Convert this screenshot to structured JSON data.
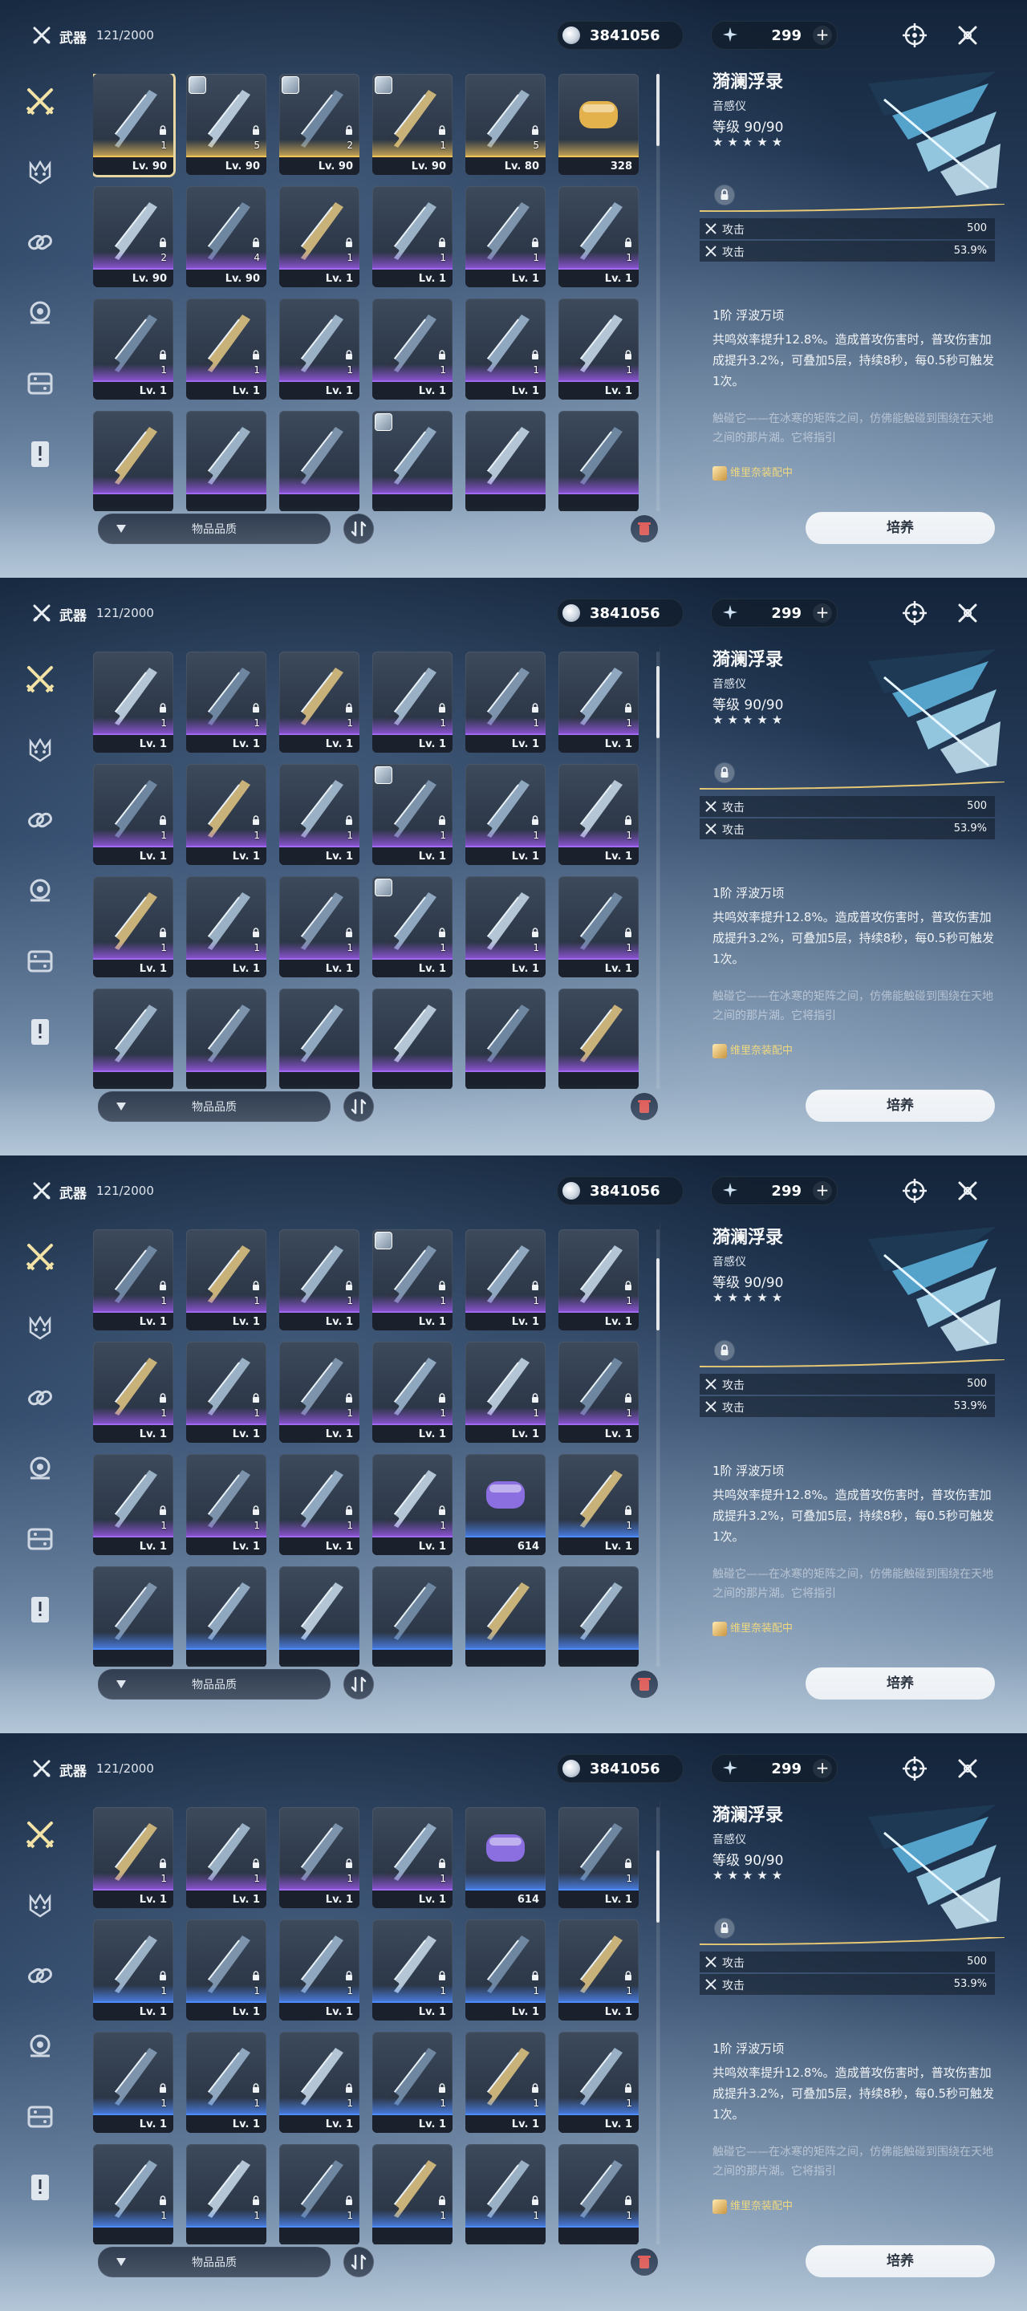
{
  "topbar": {
    "title": "武器",
    "count": "121/2000",
    "currency": "3841056",
    "gems": "299",
    "gem_plus": "+"
  },
  "filter": {
    "label": "物品品质"
  },
  "detail": {
    "name": "漪澜浮录",
    "type": "音感仪",
    "level_label": "等级",
    "level_value": "90/90",
    "stars": "★★★★★",
    "stats": [
      {
        "label": "攻击",
        "value": "500"
      },
      {
        "label": "攻击",
        "value": "53.9%"
      }
    ],
    "skill_title": "1阶 浮波万顷",
    "skill_desc": "共鸣效率提升12.8%。造成普攻伤害时，普攻伤害加成提升3.2%，可叠加5层，持续8秒，每0.5秒可触发1次。",
    "lore": "触碰它——在冰寒的矩阵之间，仿佛能触碰到围绕在天地之间的那片湖。它将指引",
    "equipped": "维里奈装配中",
    "develop": "培养"
  },
  "panels": [
    {
      "rows": [
        [
          {
            "lv": "Lv. 90",
            "n": "1",
            "q": "gold",
            "sel": true,
            "av": false
          },
          {
            "lv": "Lv. 90",
            "n": "5",
            "q": "gold",
            "av": true
          },
          {
            "lv": "Lv. 90",
            "n": "2",
            "q": "gold",
            "av": true
          },
          {
            "lv": "Lv. 90",
            "n": "1",
            "q": "gold",
            "av": true
          },
          {
            "lv": "Lv. 80",
            "n": "5",
            "q": "gold",
            "av": false
          },
          {
            "lv": "328",
            "n": "",
            "q": "gold",
            "av": false,
            "item": true
          }
        ],
        [
          {
            "lv": "Lv. 90",
            "n": "2",
            "q": "purple"
          },
          {
            "lv": "Lv. 90",
            "n": "4",
            "q": "purple"
          },
          {
            "lv": "Lv. 1",
            "n": "1",
            "q": "purple"
          },
          {
            "lv": "Lv. 1",
            "n": "1",
            "q": "purple"
          },
          {
            "lv": "Lv. 1",
            "n": "1",
            "q": "purple"
          },
          {
            "lv": "Lv. 1",
            "n": "1",
            "q": "purple"
          }
        ],
        [
          {
            "lv": "Lv. 1",
            "n": "1",
            "q": "purple"
          },
          {
            "lv": "Lv. 1",
            "n": "1",
            "q": "purple"
          },
          {
            "lv": "Lv. 1",
            "n": "1",
            "q": "purple"
          },
          {
            "lv": "Lv. 1",
            "n": "1",
            "q": "purple"
          },
          {
            "lv": "Lv. 1",
            "n": "1",
            "q": "purple"
          },
          {
            "lv": "Lv. 1",
            "n": "1",
            "q": "purple"
          }
        ],
        [
          {
            "lv": "",
            "n": "",
            "q": "purple"
          },
          {
            "lv": "",
            "n": "",
            "q": "purple"
          },
          {
            "lv": "",
            "n": "",
            "q": "purple"
          },
          {
            "lv": "",
            "n": "",
            "q": "purple",
            "av": true
          },
          {
            "lv": "",
            "n": "",
            "q": "purple"
          },
          {
            "lv": "",
            "n": "",
            "q": "purple"
          }
        ]
      ]
    },
    {
      "rows": [
        [
          {
            "lv": "Lv. 1",
            "n": "1",
            "q": "purple"
          },
          {
            "lv": "Lv. 1",
            "n": "1",
            "q": "purple"
          },
          {
            "lv": "Lv. 1",
            "n": "1",
            "q": "purple"
          },
          {
            "lv": "Lv. 1",
            "n": "1",
            "q": "purple"
          },
          {
            "lv": "Lv. 1",
            "n": "1",
            "q": "purple"
          },
          {
            "lv": "Lv. 1",
            "n": "1",
            "q": "purple"
          }
        ],
        [
          {
            "lv": "Lv. 1",
            "n": "1",
            "q": "purple"
          },
          {
            "lv": "Lv. 1",
            "n": "1",
            "q": "purple"
          },
          {
            "lv": "Lv. 1",
            "n": "1",
            "q": "purple"
          },
          {
            "lv": "Lv. 1",
            "n": "1",
            "q": "purple",
            "av": true
          },
          {
            "lv": "Lv. 1",
            "n": "1",
            "q": "purple"
          },
          {
            "lv": "Lv. 1",
            "n": "1",
            "q": "purple"
          }
        ],
        [
          {
            "lv": "Lv. 1",
            "n": "1",
            "q": "purple"
          },
          {
            "lv": "Lv. 1",
            "n": "1",
            "q": "purple"
          },
          {
            "lv": "Lv. 1",
            "n": "1",
            "q": "purple"
          },
          {
            "lv": "Lv. 1",
            "n": "1",
            "q": "purple",
            "av": true
          },
          {
            "lv": "Lv. 1",
            "n": "1",
            "q": "purple"
          },
          {
            "lv": "Lv. 1",
            "n": "1",
            "q": "purple"
          }
        ],
        [
          {
            "lv": "",
            "n": "",
            "q": "purple"
          },
          {
            "lv": "",
            "n": "",
            "q": "purple"
          },
          {
            "lv": "",
            "n": "",
            "q": "purple"
          },
          {
            "lv": "",
            "n": "",
            "q": "purple"
          },
          {
            "lv": "",
            "n": "",
            "q": "purple"
          },
          {
            "lv": "",
            "n": "",
            "q": "purple"
          }
        ]
      ]
    },
    {
      "rows": [
        [
          {
            "lv": "Lv. 1",
            "n": "1",
            "q": "purple"
          },
          {
            "lv": "Lv. 1",
            "n": "1",
            "q": "purple"
          },
          {
            "lv": "Lv. 1",
            "n": "1",
            "q": "purple"
          },
          {
            "lv": "Lv. 1",
            "n": "1",
            "q": "purple",
            "av": true
          },
          {
            "lv": "Lv. 1",
            "n": "1",
            "q": "purple"
          },
          {
            "lv": "Lv. 1",
            "n": "1",
            "q": "purple"
          }
        ],
        [
          {
            "lv": "Lv. 1",
            "n": "1",
            "q": "purple"
          },
          {
            "lv": "Lv. 1",
            "n": "1",
            "q": "purple"
          },
          {
            "lv": "Lv. 1",
            "n": "1",
            "q": "purple"
          },
          {
            "lv": "Lv. 1",
            "n": "1",
            "q": "purple"
          },
          {
            "lv": "Lv. 1",
            "n": "1",
            "q": "purple"
          },
          {
            "lv": "Lv. 1",
            "n": "1",
            "q": "purple"
          }
        ],
        [
          {
            "lv": "Lv. 1",
            "n": "1",
            "q": "purple"
          },
          {
            "lv": "Lv. 1",
            "n": "1",
            "q": "purple"
          },
          {
            "lv": "Lv. 1",
            "n": "1",
            "q": "purple"
          },
          {
            "lv": "Lv. 1",
            "n": "1",
            "q": "purple"
          },
          {
            "lv": "614",
            "n": "",
            "q": "blue",
            "item": true
          },
          {
            "lv": "Lv. 1",
            "n": "1",
            "q": "blue"
          }
        ],
        [
          {
            "lv": "",
            "n": "",
            "q": "blue"
          },
          {
            "lv": "",
            "n": "",
            "q": "blue"
          },
          {
            "lv": "",
            "n": "",
            "q": "blue"
          },
          {
            "lv": "",
            "n": "",
            "q": "blue"
          },
          {
            "lv": "",
            "n": "",
            "q": "blue"
          },
          {
            "lv": "",
            "n": "",
            "q": "blue"
          }
        ]
      ]
    },
    {
      "rows": [
        [
          {
            "lv": "Lv. 1",
            "n": "1",
            "q": "purple"
          },
          {
            "lv": "Lv. 1",
            "n": "1",
            "q": "purple"
          },
          {
            "lv": "Lv. 1",
            "n": "1",
            "q": "purple"
          },
          {
            "lv": "Lv. 1",
            "n": "1",
            "q": "purple"
          },
          {
            "lv": "614",
            "n": "",
            "q": "blue",
            "item": true
          },
          {
            "lv": "Lv. 1",
            "n": "1",
            "q": "blue"
          }
        ],
        [
          {
            "lv": "Lv. 1",
            "n": "1",
            "q": "blue"
          },
          {
            "lv": "Lv. 1",
            "n": "1",
            "q": "blue"
          },
          {
            "lv": "Lv. 1",
            "n": "1",
            "q": "blue"
          },
          {
            "lv": "Lv. 1",
            "n": "1",
            "q": "blue"
          },
          {
            "lv": "Lv. 1",
            "n": "1",
            "q": "blue"
          },
          {
            "lv": "Lv. 1",
            "n": "1",
            "q": "blue"
          }
        ],
        [
          {
            "lv": "Lv. 1",
            "n": "1",
            "q": "blue"
          },
          {
            "lv": "Lv. 1",
            "n": "1",
            "q": "blue"
          },
          {
            "lv": "Lv. 1",
            "n": "1",
            "q": "blue"
          },
          {
            "lv": "Lv. 1",
            "n": "1",
            "q": "blue"
          },
          {
            "lv": "Lv. 1",
            "n": "1",
            "q": "blue"
          },
          {
            "lv": "Lv. 1",
            "n": "1",
            "q": "blue"
          }
        ],
        [
          {
            "lv": "",
            "n": "1",
            "q": "blue"
          },
          {
            "lv": "",
            "n": "1",
            "q": "blue"
          },
          {
            "lv": "",
            "n": "1",
            "q": "blue"
          },
          {
            "lv": "",
            "n": "1",
            "q": "blue"
          },
          {
            "lv": "",
            "n": "1",
            "q": "blue"
          },
          {
            "lv": "",
            "n": "1",
            "q": "blue"
          }
        ]
      ]
    }
  ]
}
